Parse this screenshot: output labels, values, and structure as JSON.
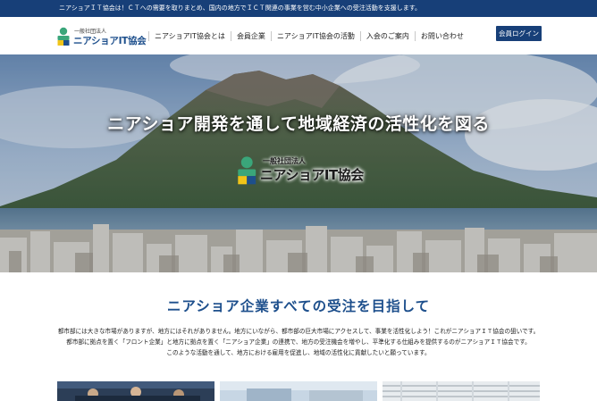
{
  "topbar": {
    "text": "ニアショアＩＴ協会は！ＣＴへの需要を取りまとめ、国内の地方でＩＣＴ関連の事業を営む中小企業への受注活動を支援します。"
  },
  "header": {
    "logo_small": "一般社団法人",
    "logo_main": "ニアショアIT協会",
    "nav": [
      "ニアショアIT協会とは",
      "会員企業",
      "ニアショアIT協会の活動",
      "入会のご案内",
      "お問い合わせ"
    ],
    "login_label": "会員ログイン"
  },
  "hero": {
    "title": "ニアショア開発を通して地域経済の活性化を図る",
    "logo_small": "一般社団法人",
    "logo_main": "ニアショアIT協会"
  },
  "intro": {
    "heading": "ニアショア企業すべての受注を目指して",
    "lines": [
      "都市部には大きな市場がありますが、地方にはそれがありません。地方にいながら、都市部の巨大市場にアクセスして、事業を活性化しよう！これがニアショアＩＴ協会の狙いです。",
      "都市部に拠点を置く「フロント企業」と地方に拠点を置く「ニアショア企業」の連携で、地方の受注機会を増やし、平準化する仕組みを提供するのがニアショアＩＴ協会です。",
      "このような活動を通して、地方における雇用を促進し、地域の活性化に貢献したいと願っています。"
    ]
  },
  "colors": {
    "brand_navy": "#173f78",
    "heading_blue": "#1d4f8c",
    "logo_green": "#3aa67a",
    "logo_yellow": "#f0c419"
  }
}
